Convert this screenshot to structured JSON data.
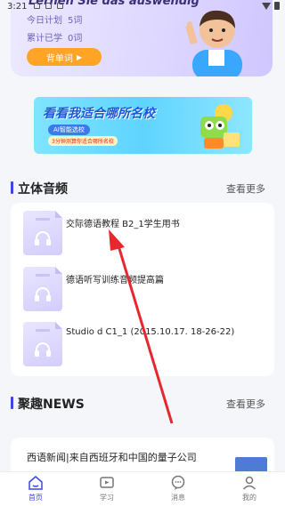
{
  "status_bar": {
    "time": "3:21"
  },
  "banner": {
    "slogan": "Lernen Sie das auswendig",
    "stats": [
      {
        "label": "今日计划",
        "value": "5词"
      },
      {
        "label": "累计已学",
        "value": "0词"
      }
    ],
    "button_label": "背单词"
  },
  "ad": {
    "title": "看看我适合哪所名校",
    "sub": "AI智能选校",
    "note": "3分钟测算你适合哪所名校"
  },
  "audio_section": {
    "title": "立体音频",
    "more": "查看更多",
    "items": [
      {
        "name": "交际德语教程 B2_1学生用书"
      },
      {
        "name": "德语听写训练音频提高篇"
      },
      {
        "name": "Studio d C1_1 (2015.10.17. 18-26-22)"
      }
    ]
  },
  "news_section": {
    "title": "聚趣NEWS",
    "more": "查看更多",
    "headline": "西语新闻|来自西班牙和中国的量子公司"
  },
  "tabs": [
    {
      "label": "首页",
      "icon": "home-icon",
      "active": true
    },
    {
      "label": "学习",
      "icon": "study-icon",
      "active": false
    },
    {
      "label": "消息",
      "icon": "message-icon",
      "active": false
    },
    {
      "label": "我的",
      "icon": "profile-icon",
      "active": false
    }
  ],
  "colors": {
    "accent": "#3d46e0",
    "button": "#ffa424",
    "annotation_arrow": "#e8262d"
  }
}
